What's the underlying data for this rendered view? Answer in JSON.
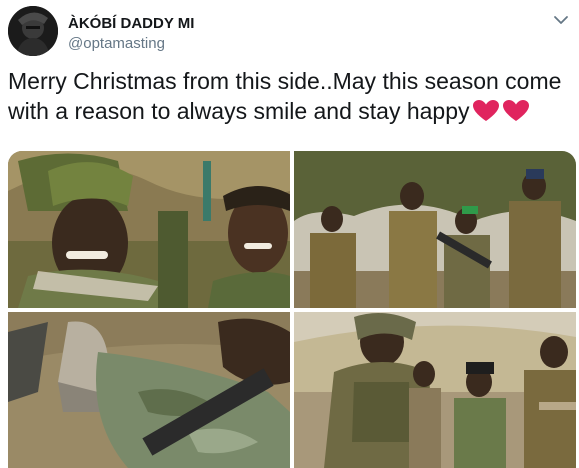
{
  "tweet": {
    "display_name": "ÀKÓBÍ DADDY MI",
    "handle": "@optamasting",
    "text": "Merry Christmas from this side..May this season come with a reason to always smile and stay happy",
    "emoji": [
      "red-heart",
      "red-heart"
    ]
  },
  "media": {
    "count": 4,
    "photos": [
      "photo-1",
      "photo-2",
      "photo-3",
      "photo-4"
    ]
  },
  "colors": {
    "heart": "#e0245e",
    "handle": "#657786",
    "text": "#14171a"
  }
}
